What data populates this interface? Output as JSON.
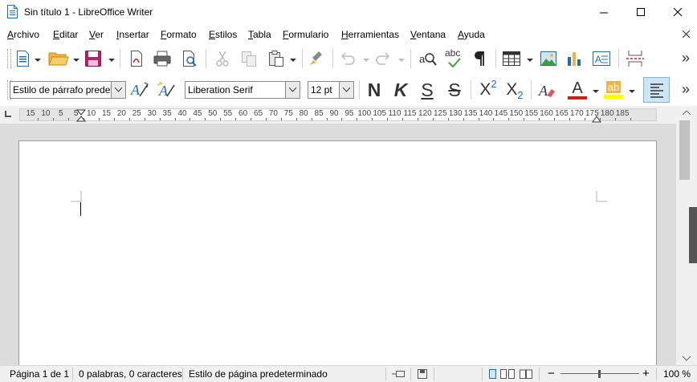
{
  "window": {
    "title": "Sin título 1 - LibreOffice Writer",
    "minimize_symbol": "–",
    "close_symbol": "✕"
  },
  "menu": {
    "items": [
      {
        "label": "Archivo"
      },
      {
        "label": "Editar"
      },
      {
        "label": "Ver"
      },
      {
        "label": "Insertar"
      },
      {
        "label": "Formato"
      },
      {
        "label": "Estilos"
      },
      {
        "label": "Tabla"
      },
      {
        "label": "Formulario"
      },
      {
        "label": "Herramientas"
      },
      {
        "label": "Ventana"
      },
      {
        "label": "Ayuda"
      }
    ],
    "close_document_symbol": "✕"
  },
  "formatting": {
    "paragraph_style": "Estilo de párrafo predeterminado",
    "font_name": "Liberation Serif",
    "font_size": "12 pt",
    "bold_glyph": "N",
    "italic_glyph": "K",
    "underline_glyph": "S",
    "strike_glyph": "S",
    "superscript_glyph": "X",
    "superscript_mark": "2",
    "subscript_glyph": "X",
    "subscript_mark": "2",
    "font_color_glyph": "A",
    "highlight_glyph": "ab",
    "spellcheck_glyph": "abc",
    "more_glyph": "»"
  },
  "ruler": {
    "ticks": [
      "15",
      "10",
      "5",
      "5",
      "10",
      "15",
      "20",
      "25",
      "30",
      "35",
      "40",
      "45",
      "50",
      "55",
      "60",
      "65",
      "70",
      "75",
      "80",
      "85",
      "90",
      "95",
      "100",
      "105",
      "110",
      "115",
      "120",
      "125",
      "130",
      "135",
      "140",
      "145",
      "150",
      "155",
      "160",
      "165",
      "170",
      "175",
      "180",
      "185"
    ]
  },
  "status": {
    "page": "Página 1 de 1",
    "words": "0 palabras, 0 caracteres",
    "page_style": "Estilo de página predeterminado",
    "zoom": "100 %",
    "zoom_minus": "−",
    "zoom_plus": "+"
  },
  "colors": {
    "font_color": "#c9211e",
    "highlight_color": "#ffff00",
    "accent_blue": "#1e6bb8",
    "active_align_bg": "#cde6f7"
  }
}
